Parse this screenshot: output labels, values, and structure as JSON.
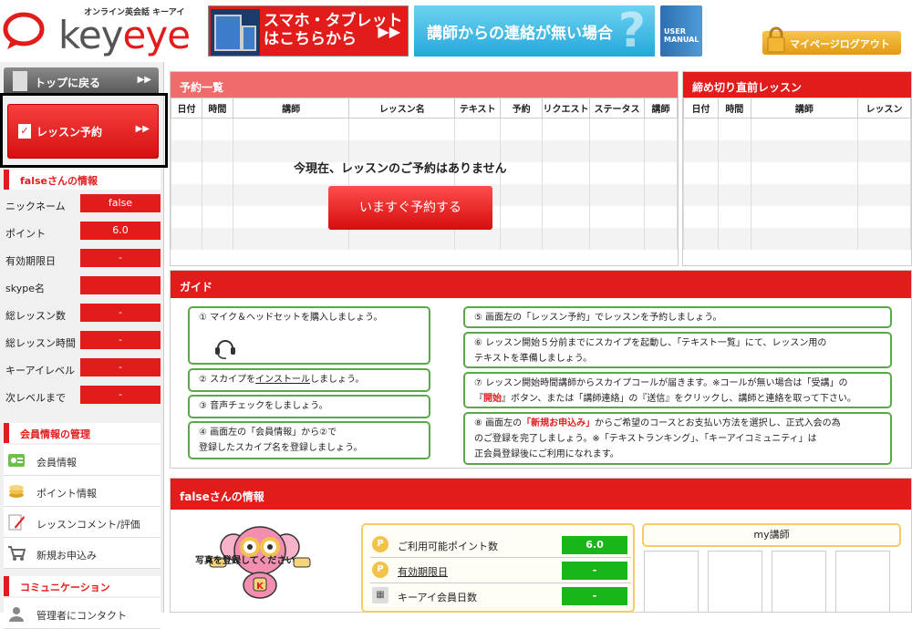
{
  "header": {
    "logo_small": "オンライン英会話 キーアイ",
    "logo_key": "key",
    "logo_eye": "eye",
    "banner_smartphone": [
      "スマホ・タブレット",
      "はこちらから"
    ],
    "banner_contact": "講師からの連絡が無い場合",
    "banner_contact_mark": "?",
    "manual_label": [
      "USER",
      "MANUAL"
    ],
    "logout_label": "マイページログアウト"
  },
  "sidebar": {
    "top_button": "トップに戻る",
    "reserve_button": "レッスン予約",
    "user_info_title": "falseさんの情報",
    "info_rows": [
      {
        "label": "ニックネーム",
        "value": "false"
      },
      {
        "label": "ポイント",
        "value": "6.0"
      },
      {
        "label": "有効期限日",
        "value": "-"
      },
      {
        "label": "skype名",
        "value": ""
      },
      {
        "label": "総レッスン数",
        "value": "-"
      },
      {
        "label": "総レッスン時間",
        "value": "-"
      },
      {
        "label": "キーアイレベル",
        "value": "-"
      },
      {
        "label": "次レベルまで",
        "value": "-"
      }
    ],
    "member_title": "会員情報の管理",
    "member_items": [
      "会員情報",
      "ポイント情報",
      "レッスンコメント/評価",
      "新規お申込み"
    ],
    "comm_title": "コミュニケーション",
    "comm_items": [
      "管理者にコンタクト"
    ]
  },
  "reservations": {
    "title": "予約一覧",
    "columns": [
      "日付",
      "時間",
      "講師",
      "レッスン名",
      "テキスト",
      "予約",
      "リクエスト",
      "ステータス",
      "講師"
    ],
    "empty_message": "今現在、レッスンのご予約はありません",
    "book_now": "いますぐ予約する"
  },
  "deadline": {
    "title": "締め切り直前レッスン",
    "columns": [
      "日付",
      "時間",
      "講師",
      "レッスン"
    ]
  },
  "guide": {
    "title": "ガイド",
    "step1": "① マイク＆ヘッドセットを購入しましょう。",
    "step2_pre": "② スカイプを",
    "step2_link": "インストール",
    "step2_post": "しましょう。",
    "step3": "③ 音声チェックをしましょう。",
    "step4_line1": "④ 画面左の「会員情報」から②で",
    "step4_line2": "登録したスカイプ名を登録しましょう。",
    "step5": "⑤ 画面左の「レッスン予約」でレッスンを予約しましょう。",
    "step6_line1": "⑥ レッスン開始５分前までにスカイプを起動し、「テキスト一覧」にて、レッスン用の",
    "step6_line2": "テキストを準備しましょう。",
    "step7_line1": "⑦ レッスン開始時間講師からスカイプコールが届きます。※コールが無い場合は「受講」の",
    "step7_a": "『",
    "step7_b": "開始",
    "step7_c": "』ボタン、または「講師連絡」の『送信』をクリックし、講師と連絡を取って下さい。",
    "step8_a": "⑧ 画面左の",
    "step8_b": "「新規お申込み」",
    "step8_c": "からご希望のコースとお支払い方法を選択し、正式入会の為",
    "step8_line2": "のご登録を完了しましょう。※「テキストランキング」、「キーアイコミュニティ」は",
    "step8_line3": "正会員登録後にご利用になれます。"
  },
  "user_info": {
    "title": "falseさんの情報",
    "photo_note": "写真を登録してください",
    "rows": [
      {
        "label": "ご利用可能ポイント数",
        "value": "6.0"
      },
      {
        "label": "有効期限日",
        "value": "-"
      },
      {
        "label": "キーアイ会員日数",
        "value": "-"
      }
    ],
    "my_teacher": "my講師"
  }
}
